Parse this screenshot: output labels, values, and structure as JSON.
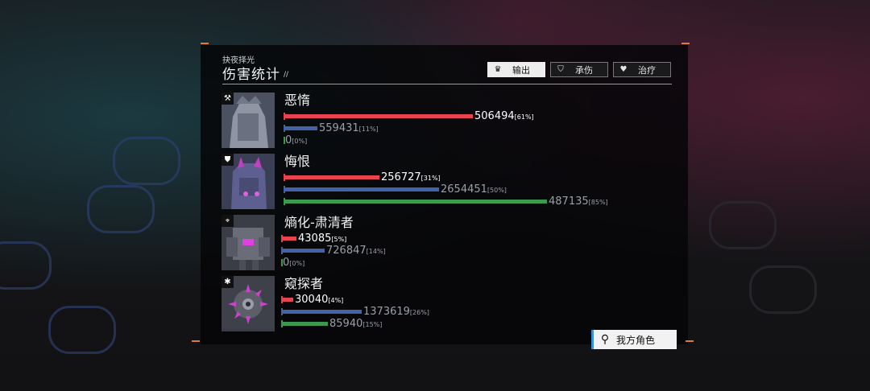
{
  "panel": {
    "subtitle": "抉夜择光",
    "title": "伤害统计",
    "title_mark": "//"
  },
  "tabs": [
    {
      "label": "输出",
      "icon": "crown-icon",
      "active": true
    },
    {
      "label": "承伤",
      "icon": "shield-icon",
      "active": false
    },
    {
      "label": "治疗",
      "icon": "heart-hand-icon",
      "active": false
    }
  ],
  "characters": [
    {
      "name": "恶惰",
      "role_icon": "hammer-icon",
      "role_glyph": "⚒",
      "output": {
        "value": "506494",
        "pct": "[61%]",
        "ratio": 0.61
      },
      "taken": {
        "value": "559431",
        "pct": "[11%]",
        "ratio": 0.11
      },
      "healing": {
        "value": "0",
        "pct": "[0%]",
        "ratio": 0.0
      }
    },
    {
      "name": "悔恨",
      "role_icon": "shield-badge-icon",
      "role_glyph": "⛊",
      "output": {
        "value": "256727",
        "pct": "[31%]",
        "ratio": 0.31
      },
      "taken": {
        "value": "2654451",
        "pct": "[50%]",
        "ratio": 0.5
      },
      "healing": {
        "value": "487135",
        "pct": "[85%]",
        "ratio": 0.85
      }
    },
    {
      "name": "熵化-肃清者",
      "role_icon": "crosshair-icon",
      "role_glyph": "⌖",
      "output": {
        "value": "43085",
        "pct": "[5%]",
        "ratio": 0.05
      },
      "taken": {
        "value": "726847",
        "pct": "[14%]",
        "ratio": 0.14
      },
      "healing": {
        "value": "0",
        "pct": "[0%]",
        "ratio": 0.0
      }
    },
    {
      "name": "窥探者",
      "role_icon": "snowflake-icon",
      "role_glyph": "✱",
      "output": {
        "value": "30040",
        "pct": "[4%]",
        "ratio": 0.04
      },
      "taken": {
        "value": "1373619",
        "pct": "[26%]",
        "ratio": 0.26
      },
      "healing": {
        "value": "85940",
        "pct": "[15%]",
        "ratio": 0.15
      }
    }
  ],
  "my_team_button": {
    "label": "我方角色",
    "icon": "person-switch-icon"
  },
  "colors": {
    "output": "#e8434f",
    "taken": "#4463a6",
    "healing": "#3d9950",
    "accent": "#e07a2c"
  }
}
